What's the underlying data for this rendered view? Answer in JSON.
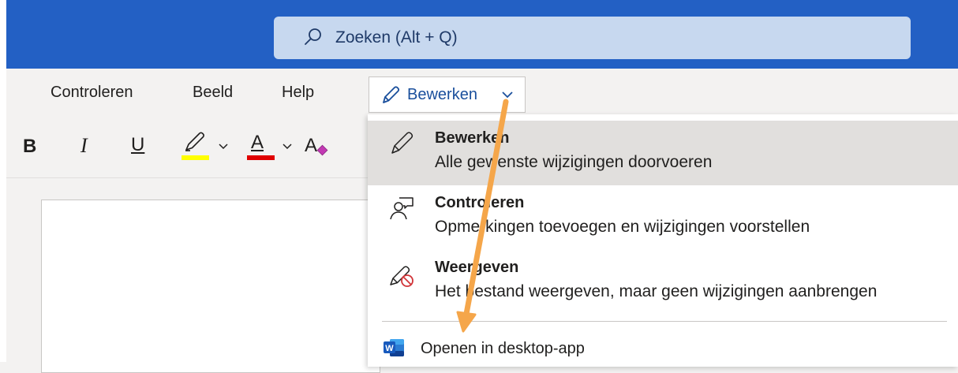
{
  "header": {
    "search": {
      "placeholder": "Zoeken (Alt + Q)",
      "icon": "search-icon"
    },
    "background_color": "#2360c4"
  },
  "menu": {
    "tabs": [
      {
        "label": "Controleren"
      },
      {
        "label": "Beeld"
      },
      {
        "label": "Help"
      }
    ],
    "mode_button": {
      "label": "Bewerken",
      "icon": "pencil-icon",
      "color": "#1a4f9c"
    }
  },
  "toolbar": {
    "bold": "B",
    "italic": "I",
    "underline": "U",
    "font_color": "A",
    "highlight_color": "#ffff00",
    "font_color_value": "#e00000",
    "clear_format_icon": "clear-formatting-icon"
  },
  "dropdown": {
    "items": [
      {
        "title": "Bewerken",
        "description": "Alle gewenste wijzigingen doorvoeren",
        "icon": "pencil-icon",
        "selected": true
      },
      {
        "title": "Controleren",
        "description": "Opmerkingen toevoegen en wijzigingen voorstellen",
        "icon": "review-person-icon",
        "selected": false
      },
      {
        "title": "Weergeven",
        "description": "Het bestand weergeven, maar geen wijzigingen aanbrengen",
        "icon": "view-no-edit-icon",
        "selected": false
      }
    ],
    "open_desktop": {
      "label": "Openen in desktop-app",
      "icon": "word-icon"
    }
  },
  "annotation": {
    "color": "#f5a64a"
  }
}
